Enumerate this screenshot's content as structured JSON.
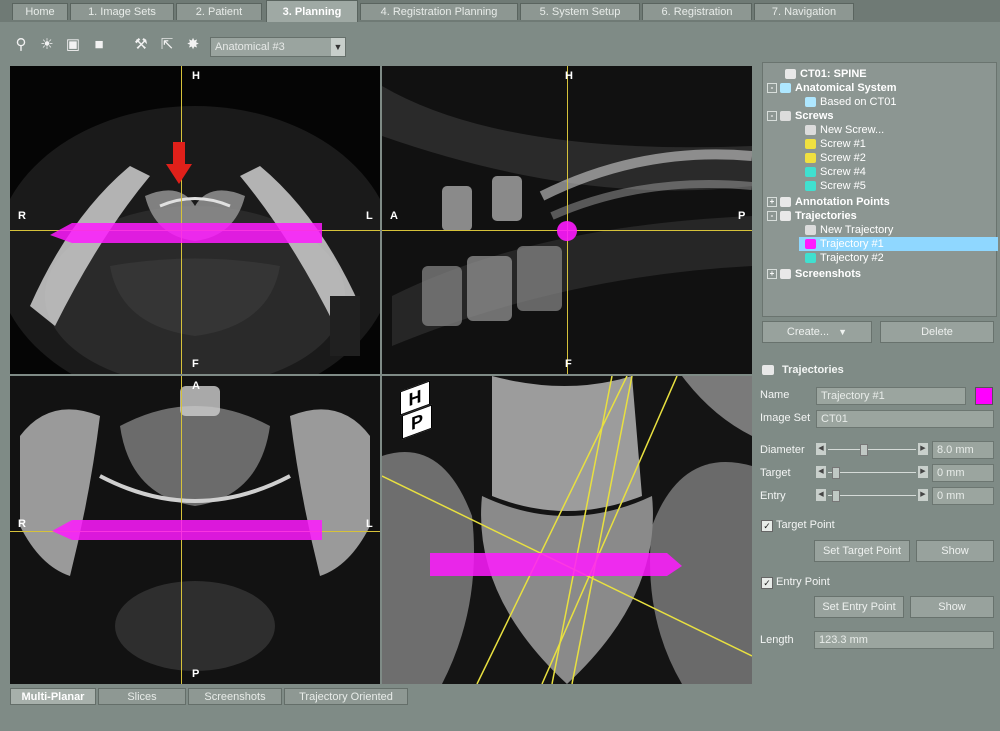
{
  "tabs": [
    {
      "label": "Home"
    },
    {
      "label": "1. Image Sets"
    },
    {
      "label": "2. Patient"
    },
    {
      "label": "3. Planning"
    },
    {
      "label": "4. Registration Planning"
    },
    {
      "label": "5. System Setup"
    },
    {
      "label": "6. Registration"
    },
    {
      "label": "7. Navigation"
    }
  ],
  "toolbar": {
    "icons": [
      "zoom-icon",
      "brightness-icon",
      "camera-icon",
      "stamp-icon",
      "screw-tool-icon",
      "trajectory-tool-icon",
      "satellite-icon"
    ],
    "view_select": "Anatomical #3"
  },
  "viewports": {
    "axial": {
      "top": "H",
      "bottom": "F",
      "left": "R",
      "right": "L"
    },
    "sagittal": {
      "top": "H",
      "bottom": "F",
      "left": "A",
      "right": "P"
    },
    "coronal": {
      "top": "A",
      "bottom": "P",
      "left": "R",
      "right": "L"
    },
    "three_d": {
      "cube_top": "H",
      "cube_front": "P"
    }
  },
  "tree": {
    "root": "CT01: SPINE",
    "anatomical_system": "Anatomical System",
    "based_on": "Based on CT01",
    "screws": "Screws",
    "new_screw": "New Screw...",
    "screw_items": [
      "Screw #1",
      "Screw #2",
      "Screw #4",
      "Screw #5"
    ],
    "annotation_points": "Annotation Points",
    "trajectories": "Trajectories",
    "new_trajectory": "New Trajectory",
    "trajectory_items": [
      "Trajectory #1",
      "Trajectory #2"
    ],
    "screenshots": "Screenshots"
  },
  "tree_buttons": {
    "create": "Create...",
    "delete": "Delete"
  },
  "panel": {
    "title": "Trajectories",
    "name_label": "Name",
    "name_value": "Trajectory #1",
    "name_color": "#ff00ff",
    "imageset_label": "Image Set",
    "imageset_value": "CT01",
    "diameter_label": "Diameter",
    "diameter_value": "8.0 mm",
    "target_label": "Target",
    "target_value": "0 mm",
    "entry_label": "Entry",
    "entry_value": "0 mm",
    "target_point_label": "Target Point",
    "set_target_point": "Set Target Point",
    "show_target": "Show",
    "entry_point_label": "Entry Point",
    "set_entry_point": "Set Entry Point",
    "show_entry": "Show",
    "length_label": "Length",
    "length_value": "123.3 mm"
  },
  "bottom_tabs": [
    {
      "label": "Multi-Planar"
    },
    {
      "label": "Slices"
    },
    {
      "label": "Screenshots"
    },
    {
      "label": "Trajectory Oriented"
    }
  ],
  "colors": {
    "trajectory": "#ff1aff",
    "crosshair": "#d6c23a",
    "selection": "#8fd7ff",
    "arrow": "#e0201a"
  }
}
